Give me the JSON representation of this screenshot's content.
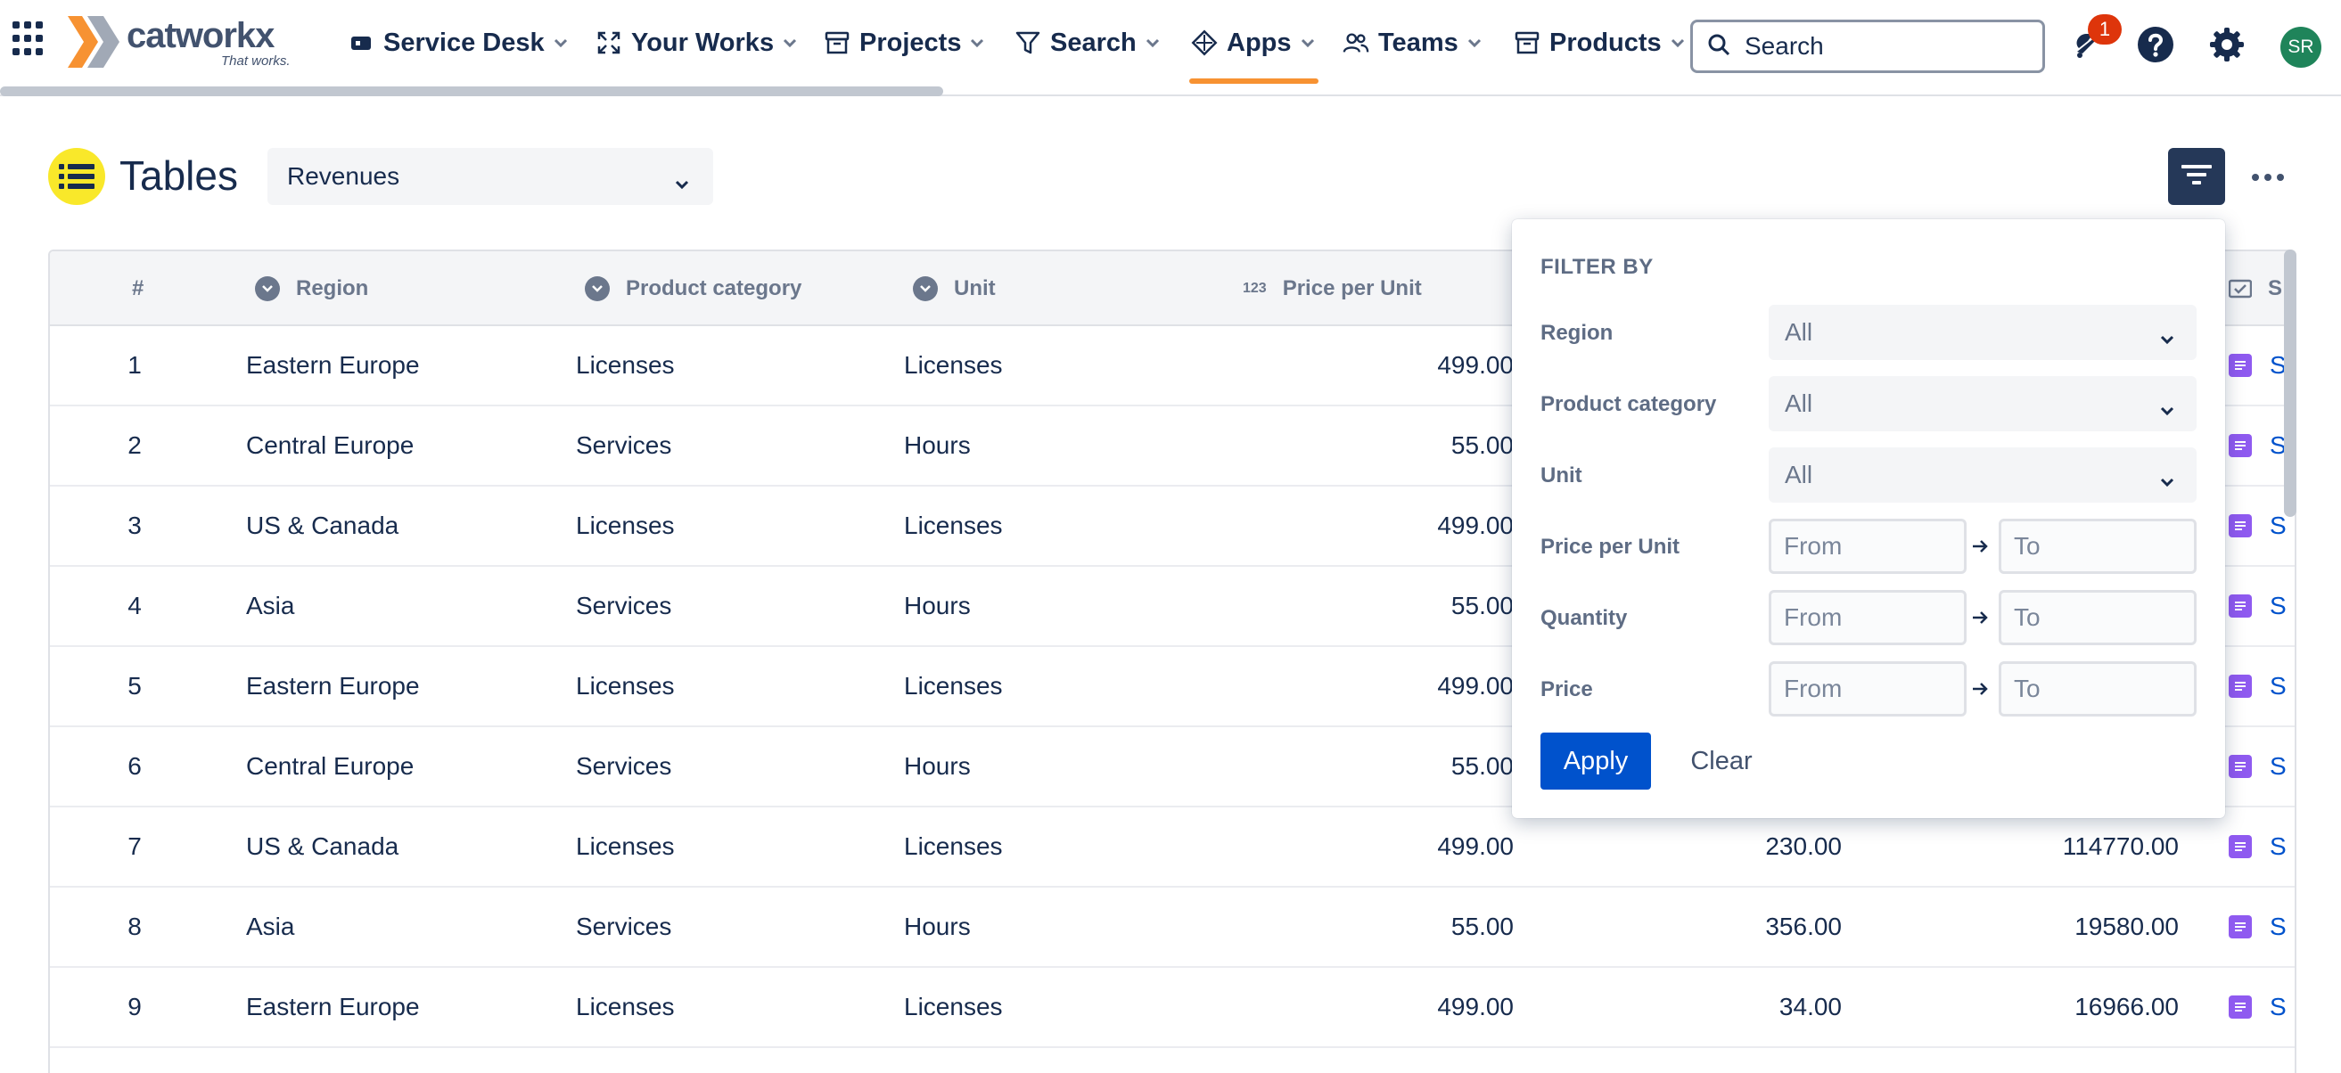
{
  "nav": {
    "logo_text": "catworkx",
    "logo_tagline": "That works.",
    "items": [
      {
        "label": "Service Desk"
      },
      {
        "label": "Your Works"
      },
      {
        "label": "Projects"
      },
      {
        "label": "Search"
      },
      {
        "label": "Apps"
      },
      {
        "label": "Teams"
      },
      {
        "label": "Products"
      }
    ],
    "active_item": "Apps",
    "search_placeholder": "Search",
    "notification_count": "1",
    "avatar_initials": "SR",
    "accent_color": "#f79232"
  },
  "page": {
    "title": "Tables",
    "table_select_value": "Revenues"
  },
  "table": {
    "columns": [
      {
        "label": "#",
        "icon": "none"
      },
      {
        "label": "Region",
        "icon": "dropdown-column-icon"
      },
      {
        "label": "Product category",
        "icon": "dropdown-column-icon"
      },
      {
        "label": "Unit",
        "icon": "dropdown-column-icon"
      },
      {
        "label": "Price per Unit",
        "icon": "number-column-icon",
        "icon_text": "123"
      },
      {
        "label": "S",
        "icon": "checkbox-column-icon"
      }
    ],
    "rows": [
      {
        "idx": "1",
        "region": "Eastern Europe",
        "category": "Licenses",
        "unit": "Licenses",
        "price_per_unit": "499.00",
        "quantity": "",
        "price": "",
        "link": "S"
      },
      {
        "idx": "2",
        "region": "Central Europe",
        "category": "Services",
        "unit": "Hours",
        "price_per_unit": "55.00",
        "quantity": "",
        "price": "",
        "link": "S"
      },
      {
        "idx": "3",
        "region": "US & Canada",
        "category": "Licenses",
        "unit": "Licenses",
        "price_per_unit": "499.00",
        "quantity": "",
        "price": "",
        "link": "S"
      },
      {
        "idx": "4",
        "region": "Asia",
        "category": "Services",
        "unit": "Hours",
        "price_per_unit": "55.00",
        "quantity": "",
        "price": "",
        "link": "S"
      },
      {
        "idx": "5",
        "region": "Eastern Europe",
        "category": "Licenses",
        "unit": "Licenses",
        "price_per_unit": "499.00",
        "quantity": "",
        "price": "",
        "link": "S"
      },
      {
        "idx": "6",
        "region": "Central Europe",
        "category": "Services",
        "unit": "Hours",
        "price_per_unit": "55.00",
        "quantity": "",
        "price": "",
        "link": "S"
      },
      {
        "idx": "7",
        "region": "US & Canada",
        "category": "Licenses",
        "unit": "Licenses",
        "price_per_unit": "499.00",
        "quantity": "230.00",
        "price": "114770.00",
        "link": "S"
      },
      {
        "idx": "8",
        "region": "Asia",
        "category": "Services",
        "unit": "Hours",
        "price_per_unit": "55.00",
        "quantity": "356.00",
        "price": "19580.00",
        "link": "S"
      },
      {
        "idx": "9",
        "region": "Eastern Europe",
        "category": "Licenses",
        "unit": "Licenses",
        "price_per_unit": "499.00",
        "quantity": "34.00",
        "price": "16966.00",
        "link": "S"
      }
    ]
  },
  "filter": {
    "title": "FILTER BY",
    "region_label": "Region",
    "region_value": "All",
    "category_label": "Product category",
    "category_value": "All",
    "unit_label": "Unit",
    "unit_value": "All",
    "ppu_label": "Price per Unit",
    "quantity_label": "Quantity",
    "price_label": "Price",
    "from_placeholder": "From",
    "to_placeholder": "To",
    "apply_label": "Apply",
    "clear_label": "Clear"
  }
}
